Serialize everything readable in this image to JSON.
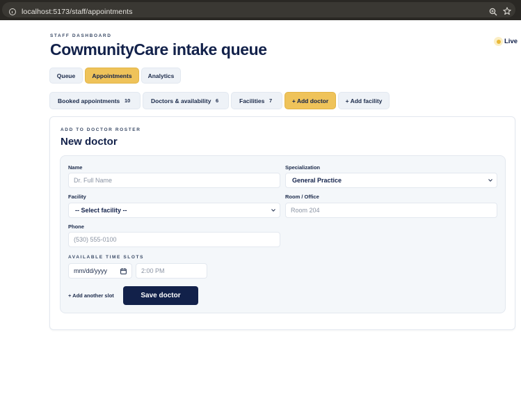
{
  "browser": {
    "url": "localhost:5173/staff/appointments",
    "icons": [
      "info-icon",
      "zoom-icon",
      "star-icon"
    ]
  },
  "header": {
    "eyebrow": "STAFF DASHBOARD",
    "title": "CowmunityCare intake queue",
    "status": {
      "label": "Live",
      "color": "#e9b93a"
    }
  },
  "tabs": [
    {
      "label": "Queue",
      "active": false
    },
    {
      "label": "Appointments",
      "active": true
    },
    {
      "label": "Analytics",
      "active": false
    }
  ],
  "sections": [
    {
      "label": "Booked appointments",
      "count": "10"
    },
    {
      "label": "Doctors & availability",
      "count": "6"
    },
    {
      "label": "Facilities",
      "count": "7"
    }
  ],
  "actions": {
    "add_doctor": "+ Add doctor",
    "add_facility": "+ Add facility"
  },
  "form": {
    "eyebrow": "ADD TO DOCTOR ROSTER",
    "title": "New doctor",
    "name": {
      "label": "Name",
      "placeholder": "Dr. Full Name",
      "value": ""
    },
    "specialization": {
      "label": "Specialization",
      "value": "General Practice"
    },
    "facility": {
      "label": "Facility",
      "value": "-- Select facility --"
    },
    "room": {
      "label": "Room / Office",
      "placeholder": "Room 204",
      "value": ""
    },
    "phone": {
      "label": "Phone",
      "placeholder": "(530) 555-0100",
      "value": ""
    },
    "slots": {
      "label": "AVAILABLE TIME SLOTS",
      "date_placeholder": "mm/dd/yyyy",
      "time_placeholder": "2:00 PM"
    },
    "add_slot": "+ Add another slot",
    "save": "Save doctor"
  },
  "colors": {
    "accent": "#efc35a",
    "navy": "#12214a",
    "panel": "#f4f7fa"
  }
}
